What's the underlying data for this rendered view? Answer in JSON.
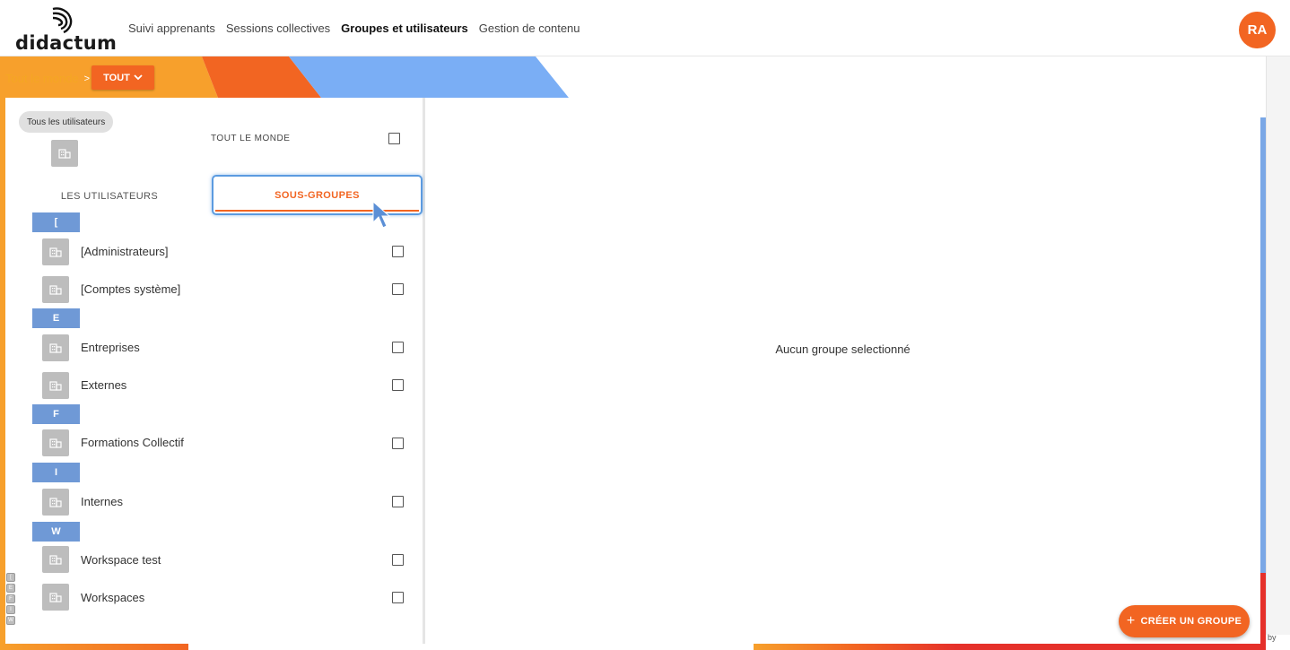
{
  "brand": {
    "name": "didactum"
  },
  "nav": [
    {
      "label": "Suivi apprenants",
      "active": false
    },
    {
      "label": "Sessions collectives",
      "active": false
    },
    {
      "label": "Groupes et utilisateurs",
      "active": true
    },
    {
      "label": "Gestion de contenu",
      "active": false
    }
  ],
  "user": {
    "initials": "RA"
  },
  "breadcrumb": {
    "root": "Tout le monde",
    "separator": ">",
    "scope_button": "TOUT"
  },
  "left": {
    "chip": "Tous les utilisateurs",
    "everyone_label": "TOUT LE MONDE",
    "tabs": {
      "users": "LES UTILISATEURS",
      "subgroups": "SOUS-GROUPES"
    },
    "groups": [
      {
        "letter": "[",
        "items": [
          "[Administrateurs]",
          "[Comptes système]"
        ]
      },
      {
        "letter": "E",
        "items": [
          "Entreprises",
          "Externes"
        ]
      },
      {
        "letter": "F",
        "items": [
          "Formations Collectif"
        ]
      },
      {
        "letter": "I",
        "items": [
          "Internes"
        ]
      },
      {
        "letter": "W",
        "items": [
          "Workspace test",
          "Workspaces"
        ]
      }
    ],
    "mini_index": [
      "[",
      "E",
      "F",
      "I",
      "W"
    ]
  },
  "right": {
    "empty_message": "Aucun groupe selectionné"
  },
  "actions": {
    "create_group": "CRÉER UN GROUPE"
  },
  "footer": {
    "by": "by"
  },
  "colors": {
    "accent": "#f26522",
    "letter_header": "#6f99d6",
    "banner_blue": "#7aaef5",
    "banner_orange": "#f7a02c"
  }
}
